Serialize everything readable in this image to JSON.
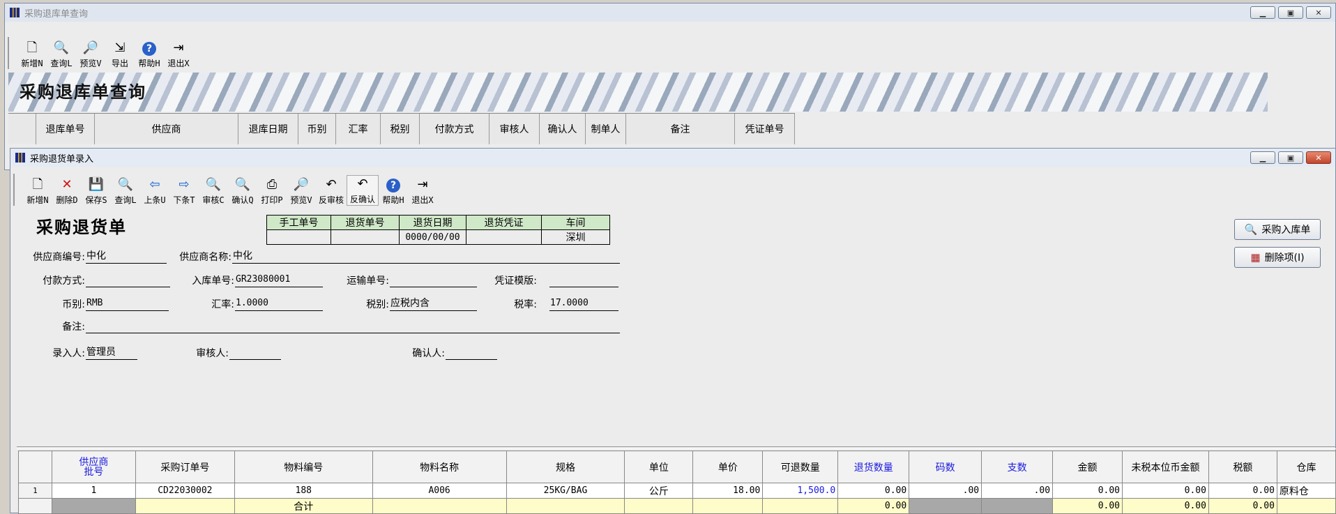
{
  "back_window": {
    "title": "采购退库单查询",
    "toolbar": [
      {
        "label": "新增N",
        "icon": "new-doc-icon"
      },
      {
        "label": "查询L",
        "icon": "query-icon"
      },
      {
        "label": "预览V",
        "icon": "preview-icon"
      },
      {
        "label": "导出",
        "icon": "export-icon"
      },
      {
        "label": "帮助H",
        "icon": "help-icon"
      },
      {
        "label": "退出X",
        "icon": "exit-icon"
      }
    ],
    "banner_title": "采购退库单查询",
    "columns": [
      "退库单号",
      "供应商",
      "退库日期",
      "币别",
      "汇率",
      "税别",
      "付款方式",
      "审核人",
      "确认人",
      "制单人",
      "备注",
      "凭证单号"
    ]
  },
  "front_window": {
    "title": "采购退货单录入",
    "toolbar": [
      {
        "label": "新增N",
        "icon": "new-doc-icon"
      },
      {
        "label": "删除D",
        "icon": "delete-icon"
      },
      {
        "label": "保存S",
        "icon": "save-icon"
      },
      {
        "label": "查询L",
        "icon": "query-icon"
      },
      {
        "label": "上条U",
        "icon": "prev-icon"
      },
      {
        "label": "下条T",
        "icon": "next-icon"
      },
      {
        "label": "审核C",
        "icon": "audit-icon"
      },
      {
        "label": "确认Q",
        "icon": "confirm-icon"
      },
      {
        "label": "打印P",
        "icon": "print-icon"
      },
      {
        "label": "预览V",
        "icon": "preview-icon"
      },
      {
        "label": "反审核",
        "icon": "unaudit-icon"
      },
      {
        "label": "反确认",
        "icon": "unconfirm-icon"
      },
      {
        "label": "帮助H",
        "icon": "help-icon"
      },
      {
        "label": "退出X",
        "icon": "exit-icon"
      }
    ],
    "form_title": "采购退货单",
    "header_table": {
      "headers": [
        "手工单号",
        "退货单号",
        "退货日期",
        "退货凭证",
        "车间"
      ],
      "values": [
        "",
        "",
        "0000/00/00",
        "",
        "深圳"
      ]
    },
    "fields": {
      "supplier_code_label": "供应商编号:",
      "supplier_code": "中化",
      "supplier_name_label": "供应商名称:",
      "supplier_name": "中化",
      "payment_label": "付款方式:",
      "payment": "",
      "receipt_no_label": "入库单号:",
      "receipt_no": "GR23080001",
      "transport_no_label": "运输单号:",
      "transport_no": "",
      "voucher_tpl_label": "凭证模版:",
      "voucher_tpl": "",
      "currency_label": "币别:",
      "currency": "RMB",
      "rate_label": "汇率:",
      "rate": "1.0000",
      "tax_type_label": "税别:",
      "tax_type": "应税内含",
      "tax_rate_label": "税率:",
      "tax_rate": "17.0000",
      "remark_label": "备注:",
      "remark": "",
      "creator_label": "录入人:",
      "creator": "管理员",
      "auditor_label": "审核人:",
      "auditor": "",
      "confirmer_label": "确认人:",
      "confirmer": ""
    },
    "side_buttons": {
      "purchase_receipt": "采购入库单",
      "delete_item": "删除项(I)"
    },
    "grid": {
      "headers": [
        "",
        "供应商批号",
        "采购订单号",
        "物料编号",
        "物料名称",
        "规格",
        "单位",
        "单价",
        "可退数量",
        "退货数量",
        "码数",
        "支数",
        "金额",
        "未税本位币金额",
        "税额",
        "仓库"
      ],
      "header_top": "供应商",
      "header_bottom": "批号",
      "row": [
        "1",
        "1",
        "CD22030002",
        "188",
        "A006",
        "25KG/BAG",
        "公斤",
        "18.00",
        "1,500.0",
        "0.00",
        ".00",
        ".00",
        "0.00",
        "0.00",
        "0.00",
        "原料仓"
      ],
      "total_label": "合计",
      "totals": {
        "return_qty": "0.00",
        "amount": "0.00",
        "untaxed": "0.00",
        "tax": "0.00"
      }
    }
  }
}
